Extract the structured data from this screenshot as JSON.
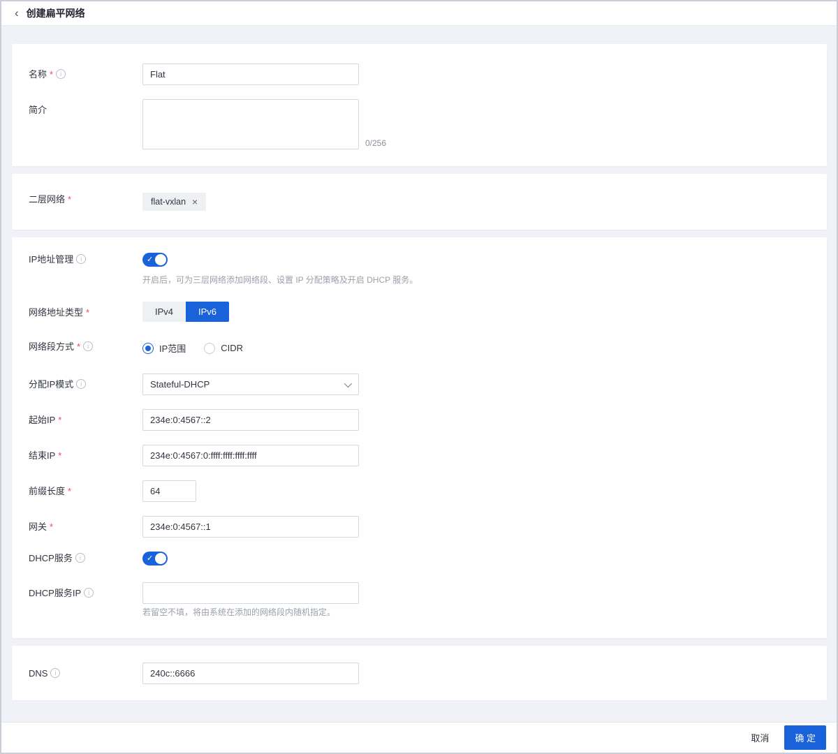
{
  "colors": {
    "accent": "#1a62d9",
    "danger": "#f04b52",
    "page_bg": "#f0f2f7"
  },
  "icons": {
    "back": "‹",
    "info": "i",
    "close": "×",
    "check": "✓"
  },
  "marks": {
    "required": "*"
  },
  "header": {
    "title": "创建扁平网络"
  },
  "basic": {
    "name": {
      "label": "名称",
      "value": "Flat"
    },
    "description": {
      "label": "简介",
      "value": "",
      "counter": "0/256"
    }
  },
  "l2": {
    "label": "二层网络",
    "tag": "flat-vxlan"
  },
  "ip": {
    "manage": {
      "label": "IP地址管理",
      "state": "on",
      "hint": "开启后，可为三层网络添加网络段、设置 IP 分配策略及开启 DHCP 服务。"
    },
    "addr_type": {
      "label": "网络地址类型",
      "options": [
        "IPv4",
        "IPv6"
      ],
      "selected": "IPv6"
    },
    "segment_mode": {
      "label": "网络段方式",
      "options": [
        "IP范围",
        "CIDR"
      ],
      "selected": "IP范围"
    },
    "alloc_mode": {
      "label": "分配IP模式",
      "value": "Stateful-DHCP"
    },
    "start_ip": {
      "label": "起始IP",
      "value": "234e:0:4567::2"
    },
    "end_ip": {
      "label": "结束IP",
      "value": "234e:0:4567:0:ffff:ffff:ffff:ffff"
    },
    "prefix_len": {
      "label": "前缀长度",
      "value": "64"
    },
    "gateway": {
      "label": "网关",
      "value": "234e:0:4567::1"
    },
    "dhcp": {
      "label": "DHCP服务",
      "state": "on"
    },
    "dhcp_ip": {
      "label": "DHCP服务IP",
      "value": "",
      "hint": "若留空不填，将由系统在添加的网络段内随机指定。"
    }
  },
  "dns": {
    "label": "DNS",
    "value": "240c::6666"
  },
  "footer": {
    "cancel": "取消",
    "confirm": "确 定"
  }
}
